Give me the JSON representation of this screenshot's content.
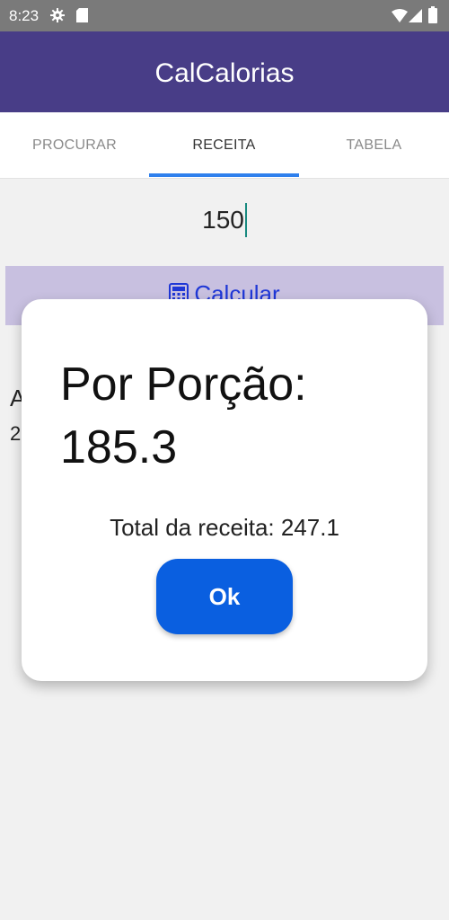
{
  "status_bar": {
    "time": "8:23",
    "icons": [
      "gear-icon",
      "sd-card-icon",
      "wifi-icon",
      "signal-icon",
      "battery-icon"
    ]
  },
  "app_bar": {
    "title": "CalCalorias",
    "color": "#483d87"
  },
  "tabs": [
    {
      "label": "PROCURAR",
      "active": false
    },
    {
      "label": "RECEITA",
      "active": true
    },
    {
      "label": "TABELA",
      "active": false
    }
  ],
  "form": {
    "quantity_value": "150",
    "calculate_label": "Calcular",
    "calculate_icon": "calculator-icon"
  },
  "background_result": {
    "line1": "A",
    "line2": "2"
  },
  "dialog": {
    "title_line1": "Por Porção:",
    "title_line2": "185.3",
    "total_text": "Total da receita: 247.1",
    "ok_label": "Ok",
    "ok_color": "#0a5fe0"
  }
}
